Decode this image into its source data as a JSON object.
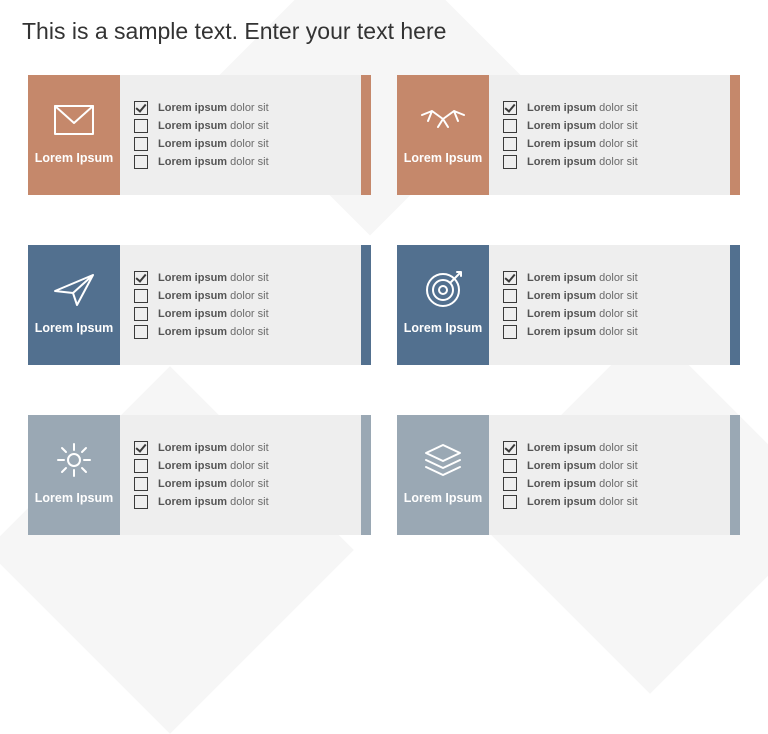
{
  "title": "This is a sample text. Enter your text here",
  "item_text": {
    "bold": "Lorem ipsum",
    "rest": " dolor sit"
  },
  "cards": [
    {
      "color": "#c5886b",
      "icon": "envelope-icon",
      "label": "Lorem Ipsum",
      "checks": [
        true,
        false,
        false,
        false
      ]
    },
    {
      "color": "#c5886b",
      "icon": "handshake-icon",
      "label": "Lorem Ipsum",
      "checks": [
        true,
        false,
        false,
        false
      ]
    },
    {
      "color": "#52708f",
      "icon": "paperplane-icon",
      "label": "Lorem Ipsum",
      "checks": [
        true,
        false,
        false,
        false
      ]
    },
    {
      "color": "#52708f",
      "icon": "target-icon",
      "label": "Lorem Ipsum",
      "checks": [
        true,
        false,
        false,
        false
      ]
    },
    {
      "color": "#9aa8b4",
      "icon": "gear-icon",
      "label": "Lorem Ipsum",
      "checks": [
        true,
        false,
        false,
        false
      ]
    },
    {
      "color": "#9aa8b4",
      "icon": "layers-icon",
      "label": "Lorem Ipsum",
      "checks": [
        true,
        false,
        false,
        false
      ]
    }
  ]
}
